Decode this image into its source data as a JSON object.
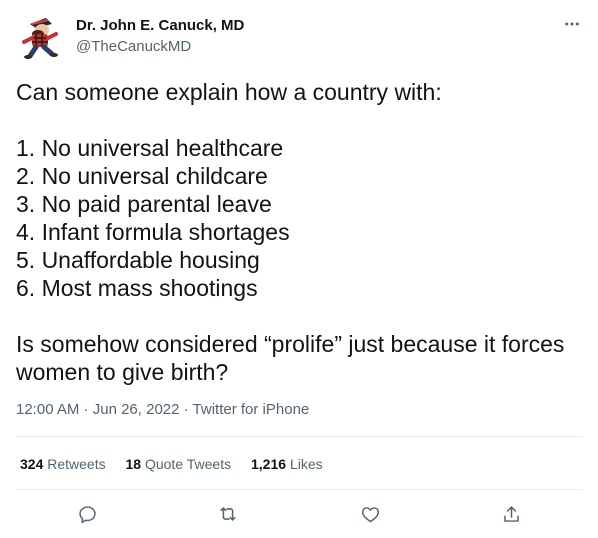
{
  "author": {
    "display_name": "Dr. John E. Canuck, MD",
    "handle": "@TheCanuckMD",
    "avatar_icon": "cartoon-character-avatar"
  },
  "tweet": {
    "intro": "Can someone explain how a country with:",
    "list": [
      "1. No universal healthcare",
      "2. No universal childcare",
      "3. No paid parental leave",
      "4. Infant formula shortages",
      "5. Unaffordable housing",
      "6. Most mass shootings"
    ],
    "closing_line1": "Is somehow considered “prolife” just because it forces",
    "closing_line2": "women to give birth?"
  },
  "meta": {
    "time": "12:00 AM",
    "sep1": " · ",
    "date": "Jun 26, 2022",
    "sep2": " · ",
    "source": "Twitter for iPhone"
  },
  "stats": {
    "retweets_count": "324",
    "retweets_label": "Retweets",
    "quotes_count": "18",
    "quotes_label": "Quote Tweets",
    "likes_count": "1,216",
    "likes_label": "Likes"
  },
  "icons": {
    "more": "more-horizontal-icon",
    "reply": "reply-icon",
    "retweet": "retweet-icon",
    "like": "heart-icon",
    "share": "share-icon"
  },
  "colors": {
    "text": "#0f1419",
    "secondary": "#536471",
    "divider": "#e6ecf0"
  }
}
